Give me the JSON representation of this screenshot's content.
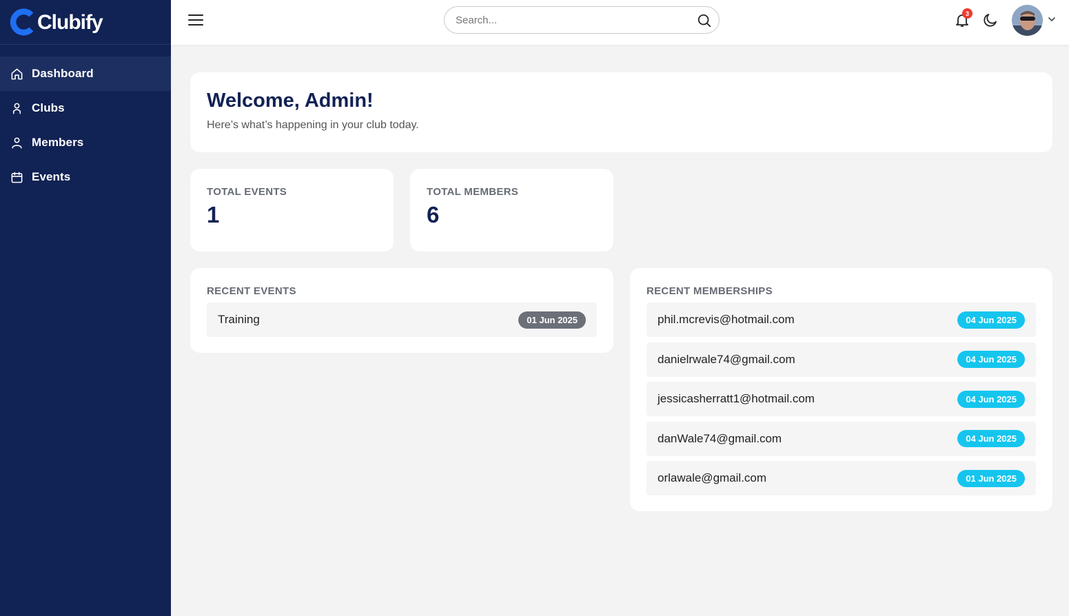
{
  "app": {
    "brand": "Clubify"
  },
  "sidebar": {
    "items": [
      {
        "label": "Dashboard",
        "icon": "home-icon",
        "active": true
      },
      {
        "label": "Clubs",
        "icon": "user-icon",
        "active": false
      },
      {
        "label": "Members",
        "icon": "user-icon",
        "active": false
      },
      {
        "label": "Events",
        "icon": "calendar-icon",
        "active": false
      }
    ]
  },
  "topbar": {
    "search_placeholder": "Search...",
    "notification_count": "3"
  },
  "welcome": {
    "title": "Welcome, Admin!",
    "subtitle": "Here’s what’s happening in your club today."
  },
  "stats": {
    "events": {
      "label": "TOTAL EVENTS",
      "value": "1"
    },
    "members": {
      "label": "TOTAL MEMBERS",
      "value": "6"
    }
  },
  "recent_events": {
    "heading": "RECENT EVENTS",
    "items": [
      {
        "title": "Training",
        "date": "01 Jun 2025"
      }
    ]
  },
  "recent_memberships": {
    "heading": "RECENT MEMBERSHIPS",
    "items": [
      {
        "email": "phil.mcrevis@hotmail.com",
        "date": "04 Jun 2025"
      },
      {
        "email": "danielrwale74@gmail.com",
        "date": "04 Jun 2025"
      },
      {
        "email": "jessicasherratt1@hotmail.com",
        "date": "04 Jun 2025"
      },
      {
        "email": "danWale74@gmail.com",
        "date": "04 Jun 2025"
      },
      {
        "email": "orlawale@gmail.com",
        "date": "01 Jun 2025"
      }
    ]
  },
  "colors": {
    "sidebar_bg": "#112254",
    "accent_blue": "#1f6ff2",
    "badge_gray": "#6b7078",
    "badge_cyan": "#15c5ee",
    "notification_red": "#ef3b2d"
  }
}
